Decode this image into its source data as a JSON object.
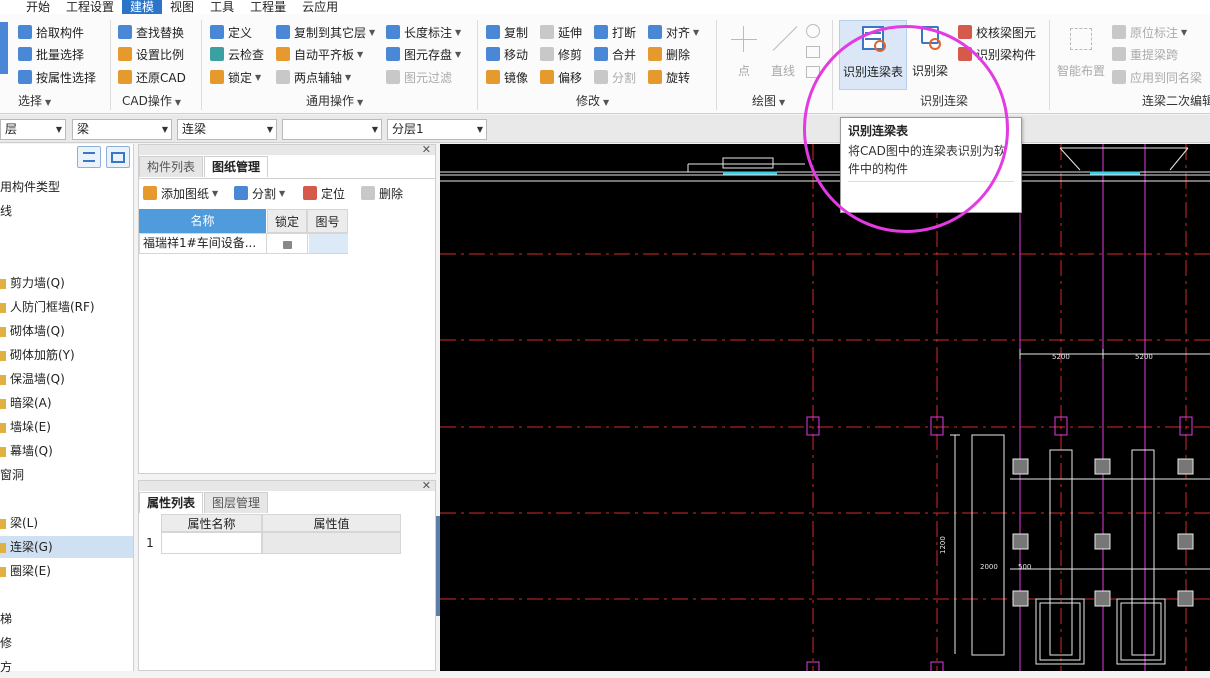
{
  "menu": {
    "items": [
      "开始",
      "工程设置",
      "建模",
      "视图",
      "工具",
      "工程量",
      "云应用"
    ],
    "active": "建模"
  },
  "ribbon": {
    "select_group": {
      "items": [
        "拾取构件",
        "批量选择",
        "按属性选择"
      ],
      "title": "选择"
    },
    "cad_group": {
      "items": [
        "查找替换",
        "设置比例",
        "还原CAD"
      ],
      "title": "CAD操作"
    },
    "common_group": {
      "items": [
        "定义",
        "云检查",
        "锁定",
        "复制到其它层",
        "自动平齐板",
        "两点辅轴",
        "长度标注",
        "图元存盘",
        "图元过滤"
      ],
      "title": "通用操作"
    },
    "modify_group": {
      "items": [
        "复制",
        "移动",
        "镜像",
        "延伸",
        "修剪",
        "偏移",
        "打断",
        "合并",
        "分割",
        "对齐",
        "删除",
        "旋转"
      ],
      "title": "修改"
    },
    "draw_group": {
      "items": [
        "点",
        "直线"
      ],
      "title": "绘图"
    },
    "recognize_group": {
      "items": [
        "识别连梁表",
        "识别梁",
        "校核梁图元",
        "识别梁构件"
      ],
      "title": "识别连梁"
    },
    "secondary_group": {
      "items": [
        "智能布置",
        "原位标注",
        "重提梁跨",
        "应用到同名梁"
      ],
      "title": "连梁二次编辑"
    }
  },
  "toolbar": {
    "layer": "层",
    "type": "梁",
    "subtype": "连梁",
    "blank": "",
    "floor": "分层1"
  },
  "tree": {
    "items": [
      "用构件类型",
      "线",
      "",
      "",
      "剪力墙(Q)",
      "人防门框墙(RF)",
      "砌体墙(Q)",
      "砌体加筋(Y)",
      "保温墙(Q)",
      "暗梁(A)",
      "墙垛(E)",
      "幕墙(Q)",
      "窗洞",
      "",
      "梁(L)",
      "连梁(G)",
      "圈梁(E)",
      "",
      "梯",
      "修",
      "方"
    ],
    "selected": "连梁(G)"
  },
  "drawings_panel": {
    "tabs": [
      "构件列表",
      "图纸管理"
    ],
    "active_tab": "图纸管理",
    "actions": [
      "添加图纸",
      "分割",
      "定位",
      "删除"
    ],
    "columns": [
      "名称",
      "锁定",
      "图号"
    ],
    "rows": [
      {
        "name": "福瑞祥1#车间设备...",
        "locked": "",
        "number": ""
      }
    ]
  },
  "props_panel": {
    "tabs": [
      "属性列表",
      "图层管理"
    ],
    "active_tab": "属性列表",
    "columns": [
      "属性名称",
      "属性值"
    ],
    "rows": [
      {
        "index": "1",
        "name": "",
        "value": ""
      }
    ]
  },
  "tooltip": {
    "title": "识别连梁表",
    "body": "将CAD图中的连梁表识别为软件中的构件"
  },
  "canvas": {
    "dims": [
      "5200",
      "5200",
      "2000",
      "500",
      "1200"
    ]
  }
}
